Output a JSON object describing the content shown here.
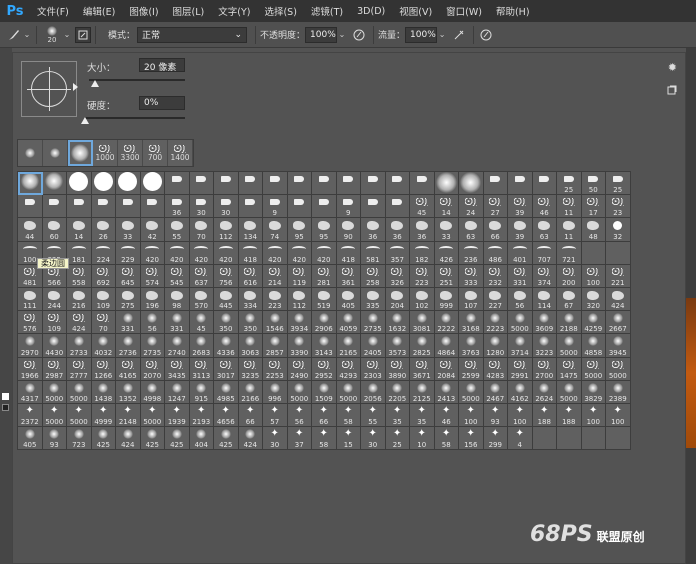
{
  "app": {
    "logo": "Ps"
  },
  "menu": [
    "文件(F)",
    "编辑(E)",
    "图像(I)",
    "图层(L)",
    "文字(Y)",
    "选择(S)",
    "滤镜(T)",
    "3D(D)",
    "视图(V)",
    "窗口(W)",
    "帮助(H)"
  ],
  "options": {
    "brush_size_label": "20",
    "mode_label": "模式：",
    "mode_value": "正常",
    "opacity_label": "不透明度：",
    "opacity_value": "100%",
    "flow_label": "流量：",
    "flow_value": "100%"
  },
  "picker": {
    "size_label": "大小：",
    "size_value": "20 像素",
    "hardness_label": "硬度：",
    "hardness_value": "0%",
    "size_fraction": 0.06,
    "hardness_fraction": 0.0,
    "tooltip": "柔边圆"
  },
  "recent": [
    "",
    "",
    "",
    "1000",
    "3300",
    "700",
    "1400"
  ],
  "grid": [
    [
      "",
      "",
      "",
      "",
      "",
      "",
      "",
      "",
      "",
      "",
      "",
      "",
      "",
      "",
      "",
      "",
      "",
      "",
      "",
      "",
      "",
      "",
      "25",
      "50",
      "25"
    ],
    [
      "",
      "",
      "",
      "",
      "",
      "",
      "36",
      "30",
      "30",
      "",
      "9",
      "",
      "",
      "9",
      "",
      "",
      "45",
      "14",
      "24",
      "27",
      "39",
      "46",
      "11",
      "17",
      "23"
    ],
    [
      "44",
      "60",
      "14",
      "26",
      "33",
      "42",
      "55",
      "70",
      "112",
      "134",
      "74",
      "95",
      "95",
      "90",
      "36",
      "36",
      "36",
      "33",
      "63",
      "66",
      "39",
      "63",
      "11",
      "48",
      "32"
    ],
    [
      "100",
      "325",
      "181",
      "224",
      "229",
      "420",
      "420",
      "420",
      "420",
      "418",
      "420",
      "420",
      "420",
      "418",
      "581",
      "357",
      "182",
      "426",
      "236",
      "486",
      "401",
      "707",
      "721",
      "",
      ""
    ],
    [
      "481",
      "566",
      "558",
      "692",
      "645",
      "574",
      "545",
      "637",
      "756",
      "616",
      "214",
      "119",
      "281",
      "361",
      "258",
      "326",
      "223",
      "251",
      "333",
      "232",
      "331",
      "374",
      "200",
      "100",
      "221"
    ],
    [
      "111",
      "244",
      "216",
      "109",
      "275",
      "196",
      "98",
      "570",
      "445",
      "334",
      "223",
      "112",
      "519",
      "405",
      "335",
      "204",
      "102",
      "999",
      "107",
      "227",
      "56",
      "114",
      "67",
      "320",
      "424"
    ],
    [
      "576",
      "109",
      "424",
      "70",
      "331",
      "56",
      "331",
      "45",
      "350",
      "350",
      "1546",
      "3934",
      "2906",
      "4059",
      "2735",
      "1632",
      "3081",
      "2222",
      "3168",
      "2223",
      "5000",
      "3609",
      "2188",
      "4259",
      "2667"
    ],
    [
      "2970",
      "4430",
      "2733",
      "4032",
      "2736",
      "2735",
      "2740",
      "2683",
      "4336",
      "3063",
      "2857",
      "3390",
      "3143",
      "2165",
      "2405",
      "3573",
      "2825",
      "4864",
      "3763",
      "1280",
      "3714",
      "3223",
      "5000",
      "4858",
      "3945"
    ],
    [
      "1966",
      "2987",
      "2777",
      "1266",
      "4165",
      "2070",
      "3435",
      "3113",
      "3017",
      "3235",
      "2253",
      "2490",
      "2952",
      "4293",
      "2303",
      "3890",
      "3671",
      "2084",
      "2599",
      "4283",
      "2991",
      "2700",
      "1475",
      "5000",
      "5000"
    ],
    [
      "4317",
      "5000",
      "5000",
      "1438",
      "1352",
      "4998",
      "1247",
      "915",
      "4985",
      "2166",
      "996",
      "5000",
      "1509",
      "5000",
      "2056",
      "2205",
      "2125",
      "2413",
      "5000",
      "2467",
      "4162",
      "2624",
      "5000",
      "3829",
      "2389"
    ],
    [
      "2372",
      "5000",
      "5000",
      "4999",
      "2148",
      "5000",
      "1939",
      "2193",
      "4656",
      "66",
      "57",
      "56",
      "66",
      "58",
      "55",
      "35",
      "35",
      "46",
      "100",
      "93",
      "100",
      "188",
      "188",
      "100",
      "100"
    ],
    [
      "405",
      "93",
      "723",
      "425",
      "424",
      "425",
      "425",
      "404",
      "425",
      "424",
      "30",
      "37",
      "58",
      "15",
      "30",
      "25",
      "10",
      "58",
      "156",
      "299",
      "4",
      "",
      "",
      "",
      ""
    ]
  ],
  "watermark": {
    "logo": "68PS",
    "text": "联盟原创"
  }
}
